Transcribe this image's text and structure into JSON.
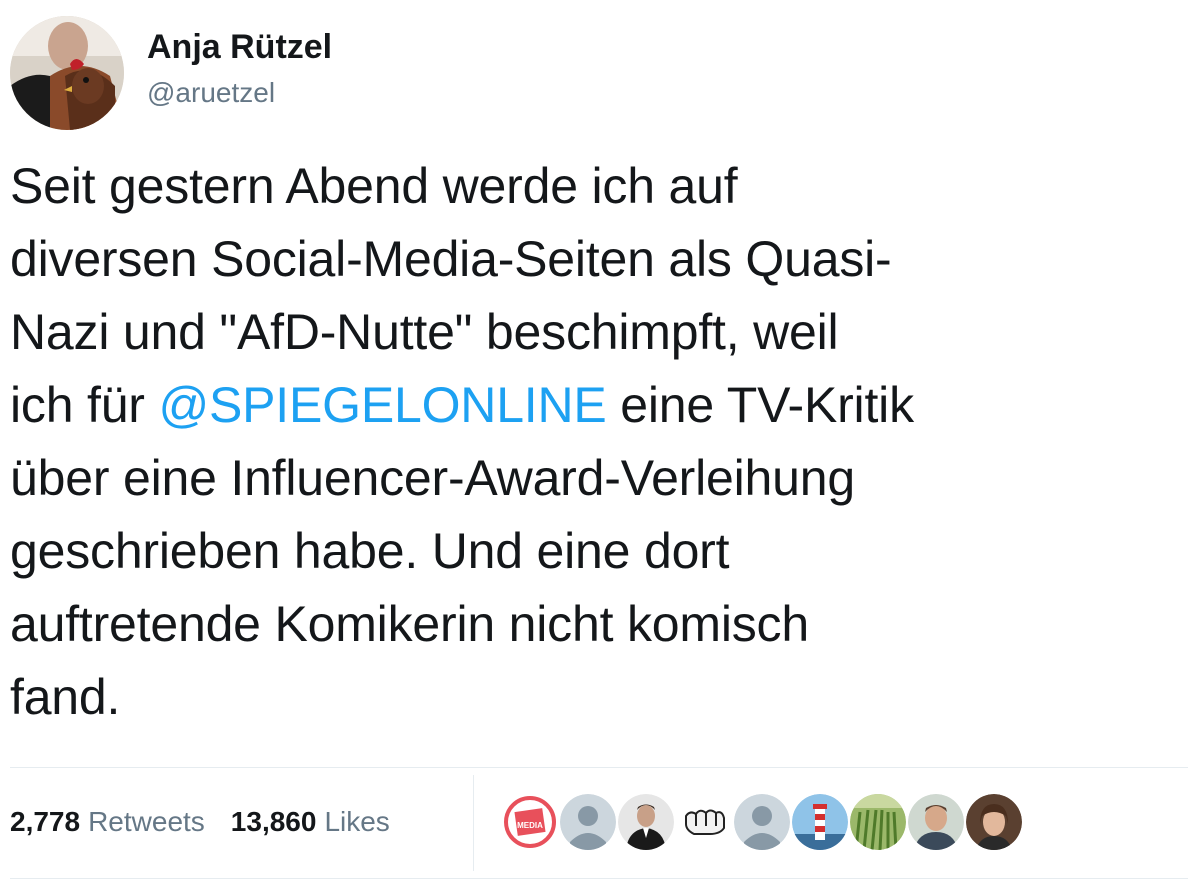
{
  "author": {
    "display_name": "Anja Rützel",
    "handle": "@aruetzel"
  },
  "tweet": {
    "lines": [
      {
        "before": "Seit gestern Abend werde ich auf"
      },
      {
        "before": "diversen Social-Media-Seiten als Quasi-"
      },
      {
        "before": "Nazi und \"AfD-Nutte\" beschimpft, weil"
      },
      {
        "before": "ich für ",
        "mention": "@SPIEGELONLINE",
        "after": " eine TV-Kritik"
      },
      {
        "before": "über eine Influencer-Award-Verleihung"
      },
      {
        "before": "geschrieben habe. Und eine dort"
      },
      {
        "before": "auftretende Komikerin nicht komisch"
      },
      {
        "before": "fand."
      }
    ],
    "mention_color": "#1da1f2"
  },
  "stats": {
    "retweets_count": "2,778",
    "retweets_label": "Retweets",
    "likes_count": "13,860",
    "likes_label": "Likes"
  },
  "likers": [
    {
      "icon": "media-logo-avatar",
      "logo_text": "MEDIA"
    },
    {
      "icon": "default-avatar"
    },
    {
      "icon": "man-in-suit-avatar"
    },
    {
      "icon": "fist-avatar"
    },
    {
      "icon": "default-avatar"
    },
    {
      "icon": "lighthouse-avatar"
    },
    {
      "icon": "field-avatar"
    },
    {
      "icon": "man-avatar"
    },
    {
      "icon": "woman-avatar"
    }
  ],
  "colors": {
    "text": "#14171a",
    "secondary": "#657786",
    "link": "#1da1f2",
    "divider": "#e6ecf0"
  }
}
